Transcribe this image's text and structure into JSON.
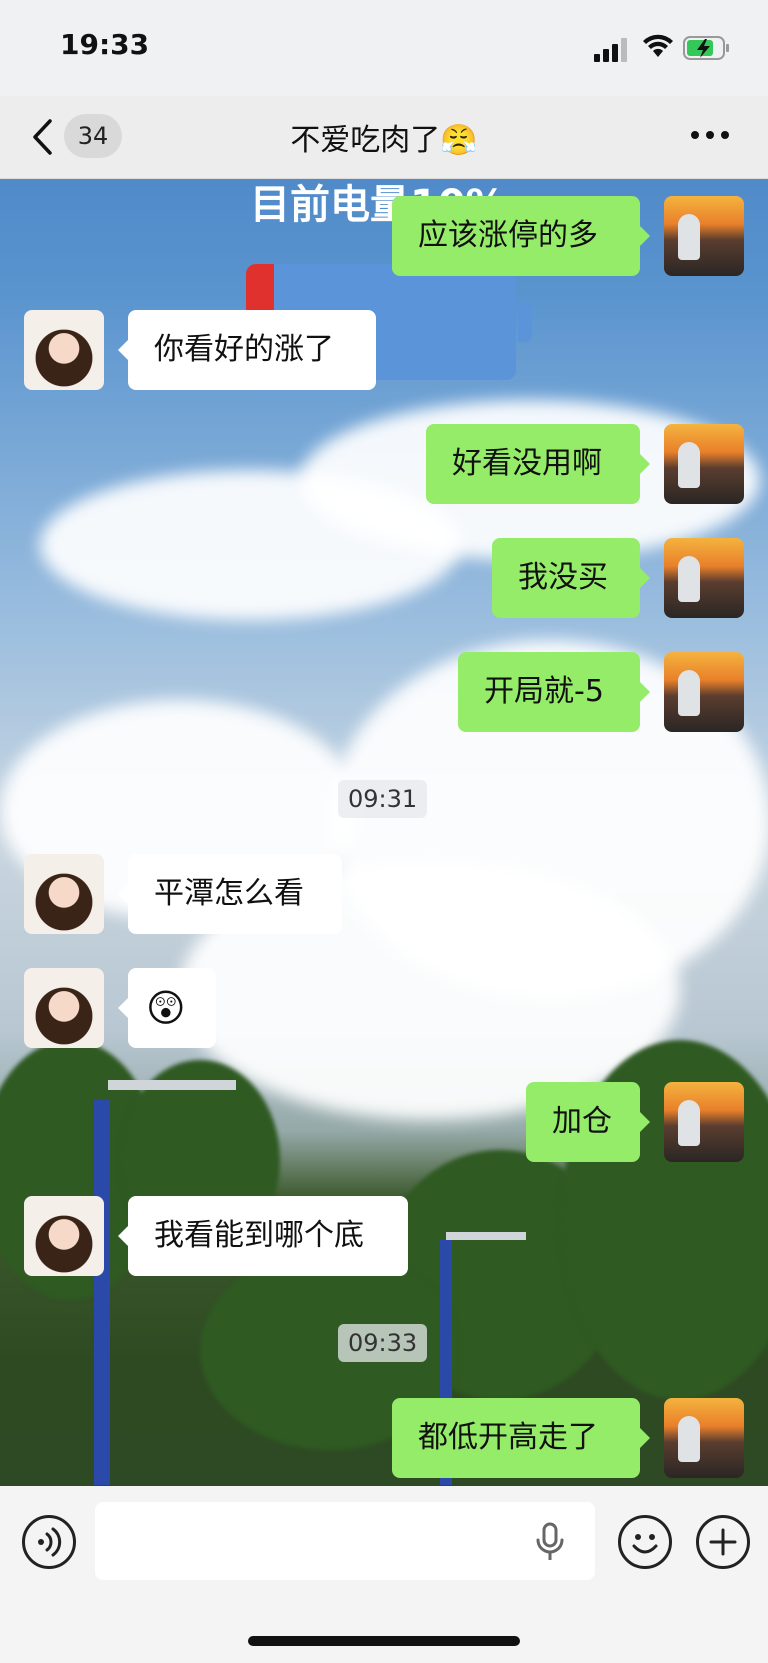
{
  "status": {
    "time": "19:33"
  },
  "nav": {
    "unread_count": "34",
    "title": "不爱吃肉了😤"
  },
  "background_overlay": {
    "text": "目前电量10%"
  },
  "messages": [
    {
      "side": "out",
      "text": "应该涨停的多"
    },
    {
      "side": "in",
      "text": "你看好的涨了"
    },
    {
      "side": "out",
      "text": "好看没用啊"
    },
    {
      "side": "out",
      "text": "我没买"
    },
    {
      "side": "out",
      "text": "开局就-5"
    },
    {
      "type": "timestamp",
      "text": "09:31"
    },
    {
      "side": "in",
      "text": "平潭怎么看"
    },
    {
      "side": "in",
      "text": "😲"
    },
    {
      "side": "out",
      "text": "加仓"
    },
    {
      "side": "in",
      "text": "我看能到哪个底"
    },
    {
      "type": "timestamp",
      "text": "09:33"
    },
    {
      "side": "out",
      "text": "都低开高走了"
    }
  ],
  "input": {
    "placeholder": ""
  },
  "colors": {
    "outgoing_bubble": "#95ec69",
    "incoming_bubble": "#ffffff"
  }
}
